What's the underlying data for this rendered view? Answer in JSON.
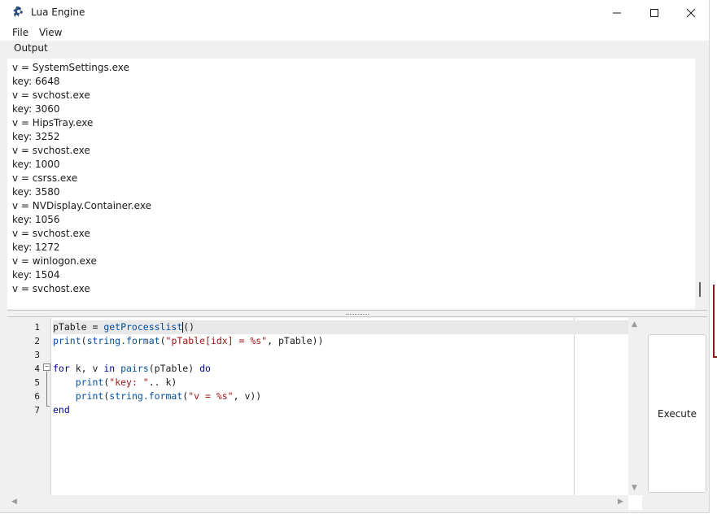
{
  "window": {
    "title": "Lua Engine",
    "icon": "lua-engine-app-icon"
  },
  "menu": {
    "file": "File",
    "view": "View"
  },
  "output": {
    "label": "Output",
    "lines": [
      "v = SystemSettings.exe",
      "key: 6648",
      "v = svchost.exe",
      "key: 3060",
      "v = HipsTray.exe",
      "key: 3252",
      "v = svchost.exe",
      "key: 1000",
      "v = csrss.exe",
      "key: 3580",
      "v = NVDisplay.Container.exe",
      "key: 1056",
      "v = svchost.exe",
      "key: 1272",
      "v = winlogon.exe",
      "key: 1504",
      "v = svchost.exe"
    ]
  },
  "editor": {
    "line_numbers": [
      "1",
      "2",
      "3",
      "4",
      "5",
      "6",
      "7"
    ],
    "code": {
      "l1_var": "pTable = ",
      "l1_fn": "getProcesslist",
      "l1_tail": "()",
      "l2_print": "print",
      "l2_open": "(",
      "l2_fn": "string.format",
      "l2_open2": "(",
      "l2_str": "\"pTable[idx] = %s\"",
      "l2_tail": ", pTable))",
      "l4_for": "for",
      "l4_mid1": " k, v ",
      "l4_in": "in",
      "l4_sp": " ",
      "l4_pairs": "pairs",
      "l4_mid2": "(pTable) ",
      "l4_do": "do",
      "l5_indent": "    ",
      "l5_print": "print",
      "l5_open": "(",
      "l5_str": "\"key: \"",
      "l5_tail": ".. k)",
      "l6_indent": "    ",
      "l6_print": "print",
      "l6_open": "(",
      "l6_fn": "string.format",
      "l6_open2": "(",
      "l6_str": "\"v = %s\"",
      "l6_tail": ", v))",
      "l7_end": "end"
    }
  },
  "execute": {
    "label": "Execute"
  },
  "colors": {
    "keyword": "#00008b",
    "function": "#0050a0",
    "string": "#a31515",
    "active_line": "#e8e8e8"
  }
}
